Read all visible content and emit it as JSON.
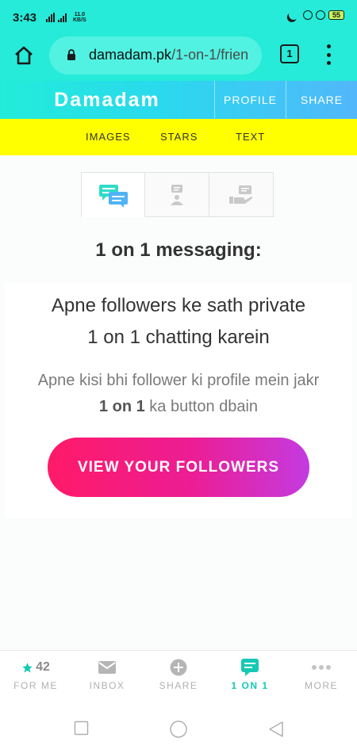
{
  "status_bar": {
    "time": "3:43",
    "net_speed_value": "11.0",
    "net_speed_unit": "KB/S",
    "battery": "55",
    "icons": [
      "signal-icon",
      "moon-icon",
      "vpn-icon",
      "alarm-icon",
      "battery-icon"
    ]
  },
  "browser": {
    "url_domain": "damadam.pk",
    "url_path": "/1-on-1/frien",
    "tab_count": "1",
    "icons": {
      "home": "home-icon",
      "lock": "lock-icon",
      "menu": "more-vert-icon"
    }
  },
  "header": {
    "brand": "Damadam",
    "profile_label": "PROFILE",
    "share_label": "SHARE"
  },
  "sub_nav": {
    "items": [
      {
        "label": "IMAGES"
      },
      {
        "label": "STARS"
      },
      {
        "label": "TEXT"
      }
    ]
  },
  "main": {
    "tabs": [
      {
        "icon": "chat-bubbles-icon",
        "active": true
      },
      {
        "icon": "person-message-icon",
        "active": false
      },
      {
        "icon": "hand-message-icon",
        "active": false
      }
    ],
    "title": "1 on 1 messaging:",
    "headline_line1": "Apne followers ke sath private",
    "headline_line2": "1 on 1 chatting karein",
    "desc_line1": "Apne kisi bhi follower ki profile mein jakr",
    "desc_bold": "1 on 1",
    "desc_rest": " ka button dbain",
    "cta_label": "VIEW YOUR FOLLOWERS"
  },
  "bottom_nav": {
    "items": [
      {
        "label": "FOR ME",
        "icon": "star-icon",
        "count": "42"
      },
      {
        "label": "INBOX",
        "icon": "mail-icon"
      },
      {
        "label": "SHARE",
        "icon": "plus-circle-icon"
      },
      {
        "label": "1 ON 1",
        "icon": "chat-icon",
        "active": true
      },
      {
        "label": "MORE",
        "icon": "dots-icon"
      }
    ]
  },
  "colors": {
    "chrome": "#25ebd8",
    "yellow": "#ffff00",
    "accent": "#15c9b6",
    "cta_start": "#ff1a68",
    "cta_end": "#c43be0"
  }
}
